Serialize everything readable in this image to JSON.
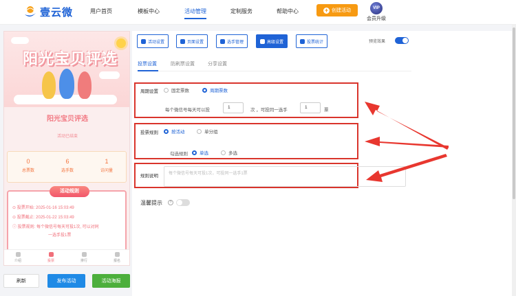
{
  "brand": {
    "name": "壹云微"
  },
  "nav": [
    "用户首页",
    "模板中心",
    "活动管理",
    "定制服务",
    "帮助中心"
  ],
  "header": {
    "create_label": "创建活动",
    "vip_badge": "VIP",
    "vip_label": "会员升级"
  },
  "preview": {
    "banner_title": "阳光宝贝评选",
    "activity_title": "阳光宝贝评选",
    "status": "活动已结束",
    "stats": [
      {
        "value": "0",
        "label": "总票数"
      },
      {
        "value": "6",
        "label": "选手数"
      },
      {
        "value": "1",
        "label": "访问量"
      }
    ],
    "rules_title": "活动规则",
    "rules": [
      "投票开始: 2025-01-16 15:03:49",
      "投票截止: 2025-01-22 15:03:49",
      "投票规则: 每个微信号每天可投1次, 可以对同",
      "一选手投1票"
    ],
    "tabbar": [
      "介绍",
      "投票",
      "排行",
      "报名"
    ]
  },
  "bottom": {
    "refresh": "刷新",
    "publish": "发布活动",
    "poster": "活动海报"
  },
  "toolbar": [
    "活动设置",
    "页面设置",
    "选手管理",
    "高级设置",
    "投票统计"
  ],
  "preview_effect_label": "预览效果",
  "subtabs": [
    "投票设置",
    "防刷票设置",
    "分享设置"
  ],
  "form": {
    "cycle_label": "周期设置",
    "cycle_options": [
      "固定票数",
      "周期票数"
    ],
    "cycle_text_1": "每个微信号每天可以投",
    "cycle_value_1": "1",
    "cycle_text_2": "次 ，可投同一选手",
    "cycle_value_2": "1",
    "cycle_text_3": "票",
    "rule_label": "投票规则",
    "rule_options": [
      "按活动",
      "单分组"
    ],
    "select_label": "勾选规则",
    "select_options": [
      "单选",
      "多选"
    ],
    "desc_label": "规则说明",
    "desc_placeholder": "每个微信号每天可投1次，可投同一选手1票",
    "tips_label": "温馨提示",
    "tips_help": "?"
  },
  "colors": {
    "brand": "#1f63d6",
    "orange": "#f79a12",
    "pink": "#f06f7a",
    "highlight": "#d9342b",
    "green": "#4caf3c"
  }
}
